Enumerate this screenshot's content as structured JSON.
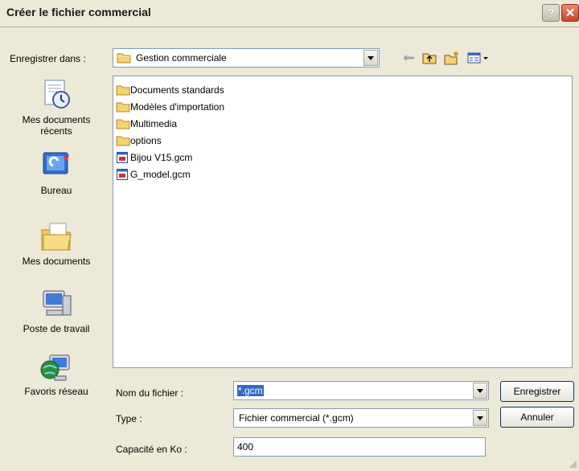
{
  "window": {
    "title": "Créer le fichier commercial",
    "help_label": "?",
    "close_label": "✕"
  },
  "location": {
    "label": "Enregistrer dans :",
    "value": "Gestion commerciale",
    "icon": "folder-icon"
  },
  "toolbar": {
    "icons": [
      "back-arrow-icon",
      "up-folder-icon",
      "new-folder-icon",
      "view-menu-icon"
    ]
  },
  "places": [
    {
      "label": "Mes documents récents",
      "icon": "recent-documents-icon"
    },
    {
      "label": "Bureau",
      "icon": "desktop-icon"
    },
    {
      "label": "Mes documents",
      "icon": "my-documents-icon"
    },
    {
      "label": "Poste de travail",
      "icon": "my-computer-icon"
    },
    {
      "label": "Favoris réseau",
      "icon": "network-places-icon"
    }
  ],
  "files": [
    {
      "name": "Documents standards",
      "type": "folder"
    },
    {
      "name": "Modèles d'importation",
      "type": "folder"
    },
    {
      "name": "Multimedia",
      "type": "folder"
    },
    {
      "name": "options",
      "type": "folder"
    },
    {
      "name": "Bijou V15.gcm",
      "type": "gcm-file"
    },
    {
      "name": "G_model.gcm",
      "type": "gcm-file"
    }
  ],
  "form": {
    "filename_label": "Nom du fichier :",
    "filename_value": "*.gcm",
    "type_label": "Type :",
    "type_value": "Fichier commercial (*.gcm)",
    "capacity_label": "Capacité en Ko :",
    "capacity_value": "400"
  },
  "buttons": {
    "save": "Enregistrer",
    "cancel": "Annuler"
  },
  "colors": {
    "window_bg": "#ece9d8",
    "close_button": "#c7452a",
    "field_border": "#7f9db9",
    "folder_yellow": "#f5d372"
  }
}
